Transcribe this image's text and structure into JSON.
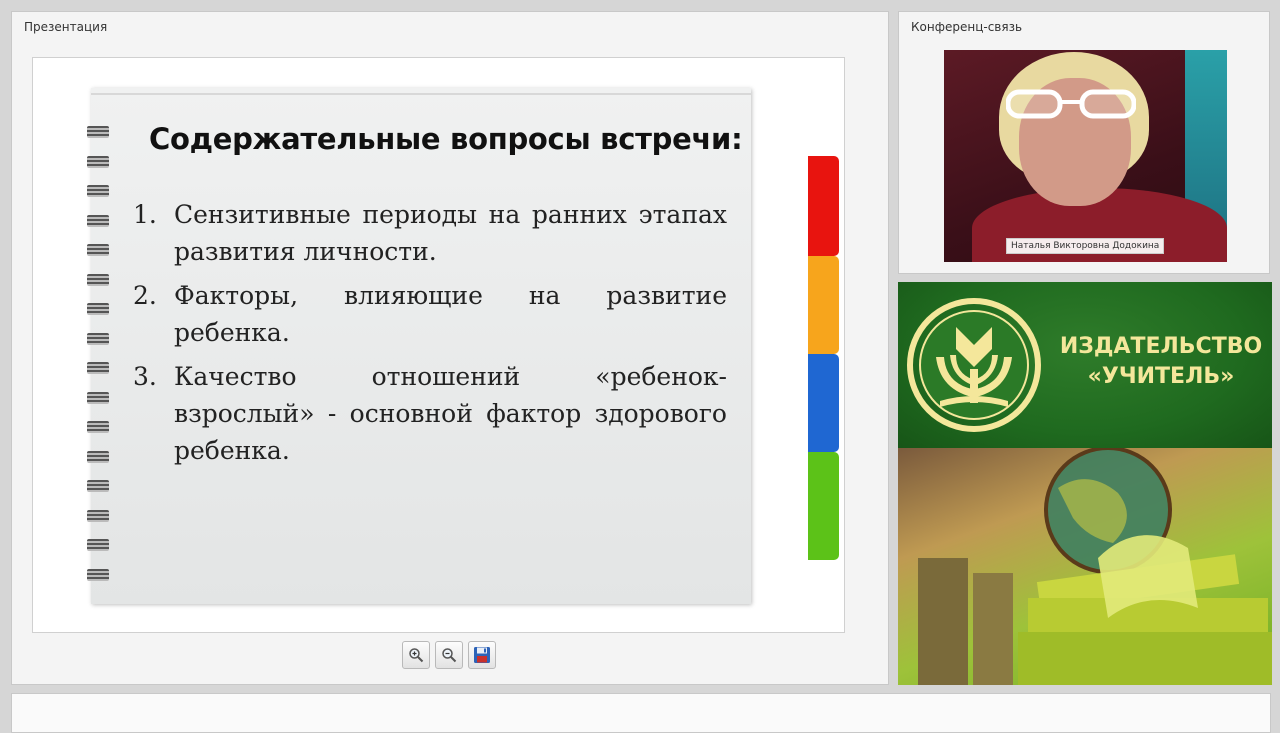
{
  "presentation_panel": {
    "title": "Презентация",
    "slide": {
      "title": "Содержательные вопросы встречи:",
      "items": [
        {
          "number": "1.",
          "text": "Сензитивные периоды на ранних этапах развития личности."
        },
        {
          "number": "2.",
          "text": "Факторы, влияющие на развитие ребенка."
        },
        {
          "number": "3.",
          "text": "Качество отношений «ребенок-взрослый» - основной фактор здорового ребенка."
        }
      ],
      "tab_colors": [
        "#e8140f",
        "#f7a51c",
        "#1f67d2",
        "#5cc218"
      ]
    },
    "toolbar": {
      "buttons": [
        {
          "name": "zoom-in-button",
          "icon": "zoom-in-icon"
        },
        {
          "name": "zoom-out-button",
          "icon": "zoom-out-icon"
        },
        {
          "name": "save-button",
          "icon": "floppy-disk-icon"
        }
      ]
    }
  },
  "conference_panel": {
    "title": "Конференц-связь",
    "participant_name": "Наталья Викторовна Додокина"
  },
  "publisher_banner": {
    "line1": "ИЗДАТЕЛЬСТВО",
    "line2": "«УЧИТЕЛЬ»",
    "brand_color": "#1f6a1f",
    "text_color": "#f4e79b"
  }
}
